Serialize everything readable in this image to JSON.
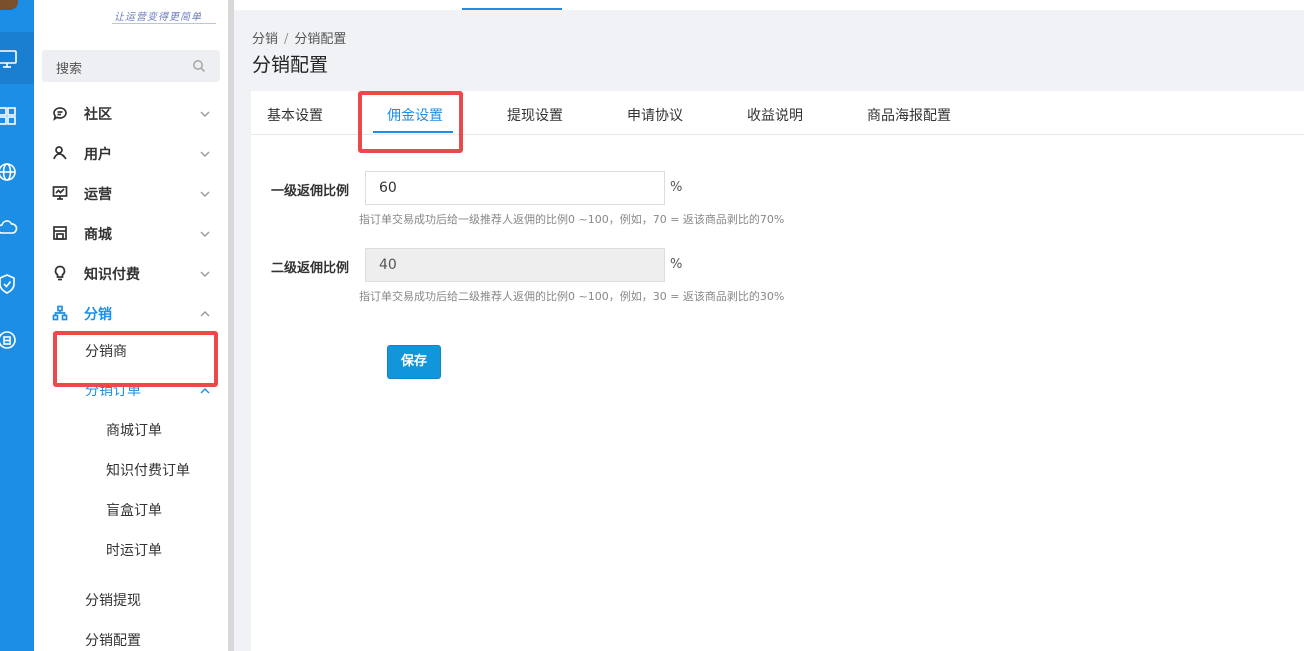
{
  "rail": {
    "icons": [
      "monitor-icon",
      "apps-grid-icon",
      "globe-icon",
      "cloud-icon",
      "shield-check-icon",
      "cloud-storage-icon"
    ]
  },
  "sidebar": {
    "brand": "让运营变得更简单",
    "search_placeholder": "搜索",
    "items": [
      {
        "label": "社区",
        "icon": "community-chat-icon"
      },
      {
        "label": "用户",
        "icon": "user-icon"
      },
      {
        "label": "运营",
        "icon": "operations-monitor-icon"
      },
      {
        "label": "商城",
        "icon": "store-icon"
      },
      {
        "label": "知识付费",
        "icon": "lightbulb-icon"
      },
      {
        "label": "分销",
        "icon": "org-tree-icon"
      }
    ],
    "distribution_sub": {
      "distributor": "分销商",
      "orders": "分销订单",
      "order_items": [
        "商城订单",
        "知识付费订单",
        "盲盒订单",
        "时运订单"
      ],
      "withdraw": "分销提现",
      "config": "分销配置"
    }
  },
  "breadcrumb": {
    "root": "分销",
    "separator": "/",
    "current": "分销配置"
  },
  "page_title": "分销配置",
  "tabs": [
    "基本设置",
    "佣金设置",
    "提现设置",
    "申请协议",
    "收益说明",
    "商品海报配置"
  ],
  "active_tab": "佣金设置",
  "form": {
    "level1": {
      "label": "一级返佣比例",
      "value": "60",
      "unit": "%",
      "hint": "指订单交易成功后给一级推荐人返佣的比例0 ~100，例如，70 = 返该商品剥比的70%"
    },
    "level2": {
      "label": "二级返佣比例",
      "value": "40",
      "unit": "%",
      "hint": "指订单交易成功后给二级推荐人返佣的比例0 ~100，例如，30 = 返该商品剥比的30%"
    },
    "save_label": "保存"
  },
  "colors": {
    "primary": "#1d8ee6",
    "annotation": "#ec4a4a",
    "save_button": "#1296db"
  }
}
